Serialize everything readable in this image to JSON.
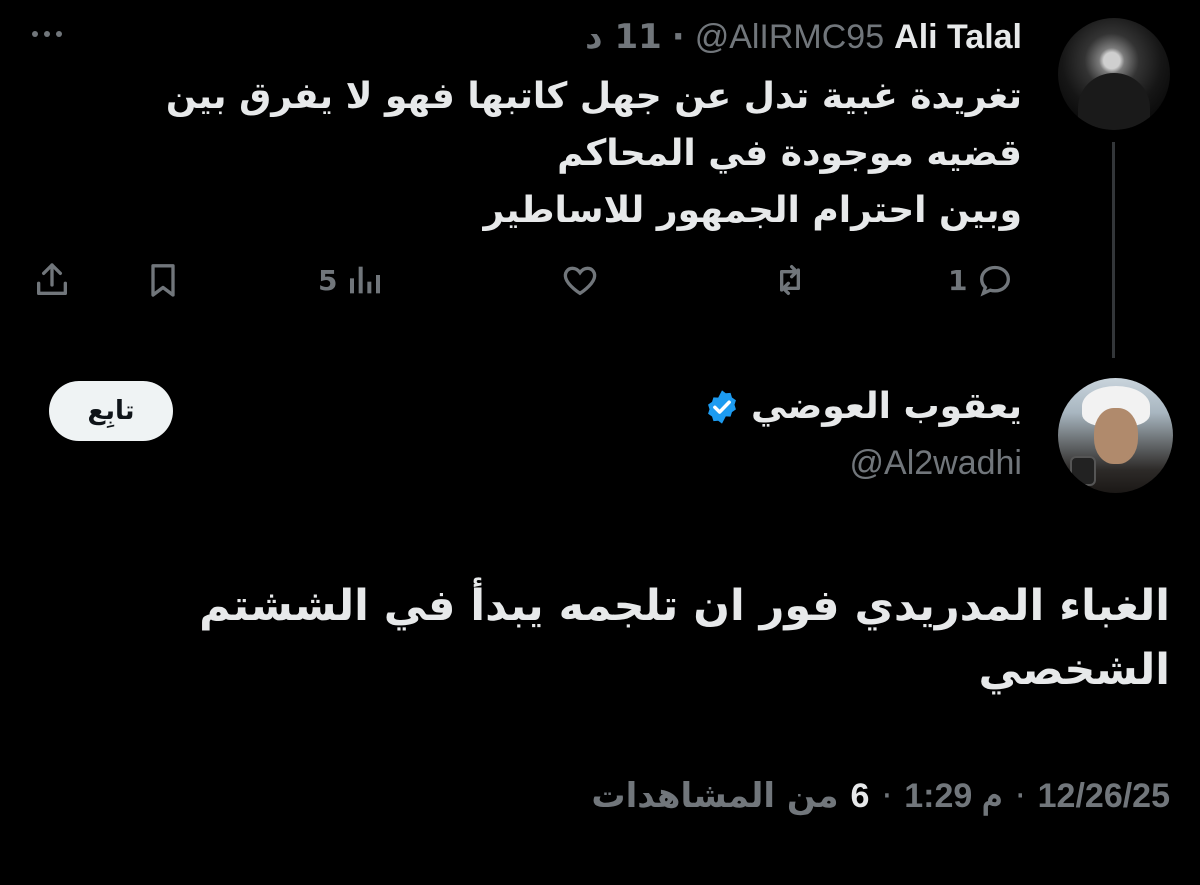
{
  "parent_tweet": {
    "author_name": "Ali Talal",
    "handle": "@AlIRMC95",
    "separator": "·",
    "time_ago": "11 د",
    "text_lines": [
      "تغريدة غبية تدل عن جهل كاتبها فهو لا يفرق بين",
      "قضيه موجودة في المحاكم",
      "وبين احترام الجمهور للاساطير"
    ],
    "stats": {
      "replies": "1",
      "retweets": "",
      "likes": "",
      "views": "5"
    },
    "icons": [
      "more-icon",
      "reply-icon",
      "retweet-icon",
      "like-icon",
      "views-icon",
      "bookmark-icon",
      "share-icon"
    ]
  },
  "main_tweet": {
    "author_name": "يعقوب العوضي",
    "handle": "@Al2wadhi",
    "verified": true,
    "follow_label": "تابِع",
    "text_lines": [
      "الغباء المدريدي فور ان تلجمه يبدأ في الششتم",
      "الشخصي"
    ],
    "meta": {
      "date": "12/26/25",
      "dot": "·",
      "time": "1:29 م",
      "views_count": "6",
      "views_label": "من المشاهدات"
    }
  },
  "colors": {
    "background": "#000000",
    "text": "#e7e9ea",
    "muted": "#71767b",
    "verified": "#1d9bf0",
    "thread_line": "#333639"
  }
}
